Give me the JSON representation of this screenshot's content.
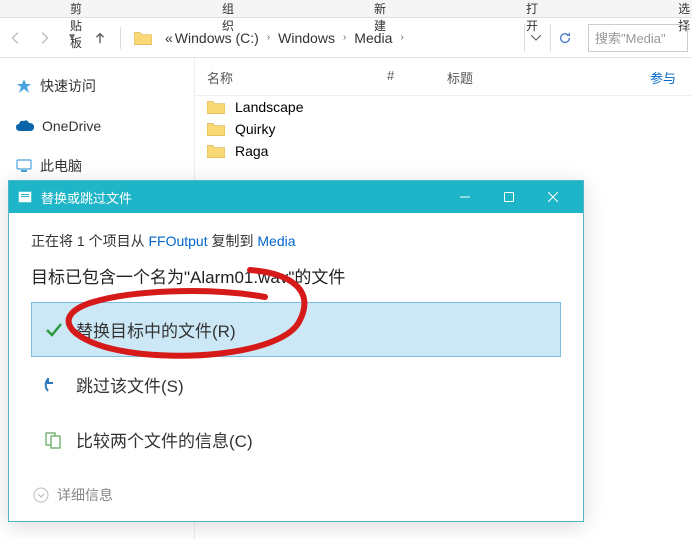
{
  "top_toolbar": {
    "item1": "剪贴板",
    "item2": "组织",
    "item3": "新建",
    "item4": "打开",
    "item5": "选择"
  },
  "addressbar": {
    "prefix": "«",
    "crumb1": "Windows (C:)",
    "crumb2": "Windows",
    "crumb3": "Media",
    "search_placeholder": "搜索\"Media\""
  },
  "sidebar": {
    "quick_access": "快速访问",
    "onedrive": "OneDrive",
    "this_pc": "此电脑"
  },
  "columns": {
    "name": "名称",
    "num": "#",
    "title": "标题",
    "more": "参与"
  },
  "files": {
    "item1": "Landscape",
    "item2": "Quirky",
    "item3": "Raga"
  },
  "dialog": {
    "title": "替换或跳过文件",
    "status_prefix": "正在将 1 个项目从 ",
    "status_source": "FFOutput",
    "status_mid": " 复制到 ",
    "status_dest": "Media",
    "conflict_prefix": "目标已包含一个名为\"",
    "conflict_filename": "Alarm01.wav",
    "conflict_suffix": "\"的文件",
    "option_replace": "替换目标中的文件(R)",
    "option_skip": "跳过该文件(S)",
    "option_compare": "比较两个文件的信息(C)",
    "details": "详细信息"
  }
}
